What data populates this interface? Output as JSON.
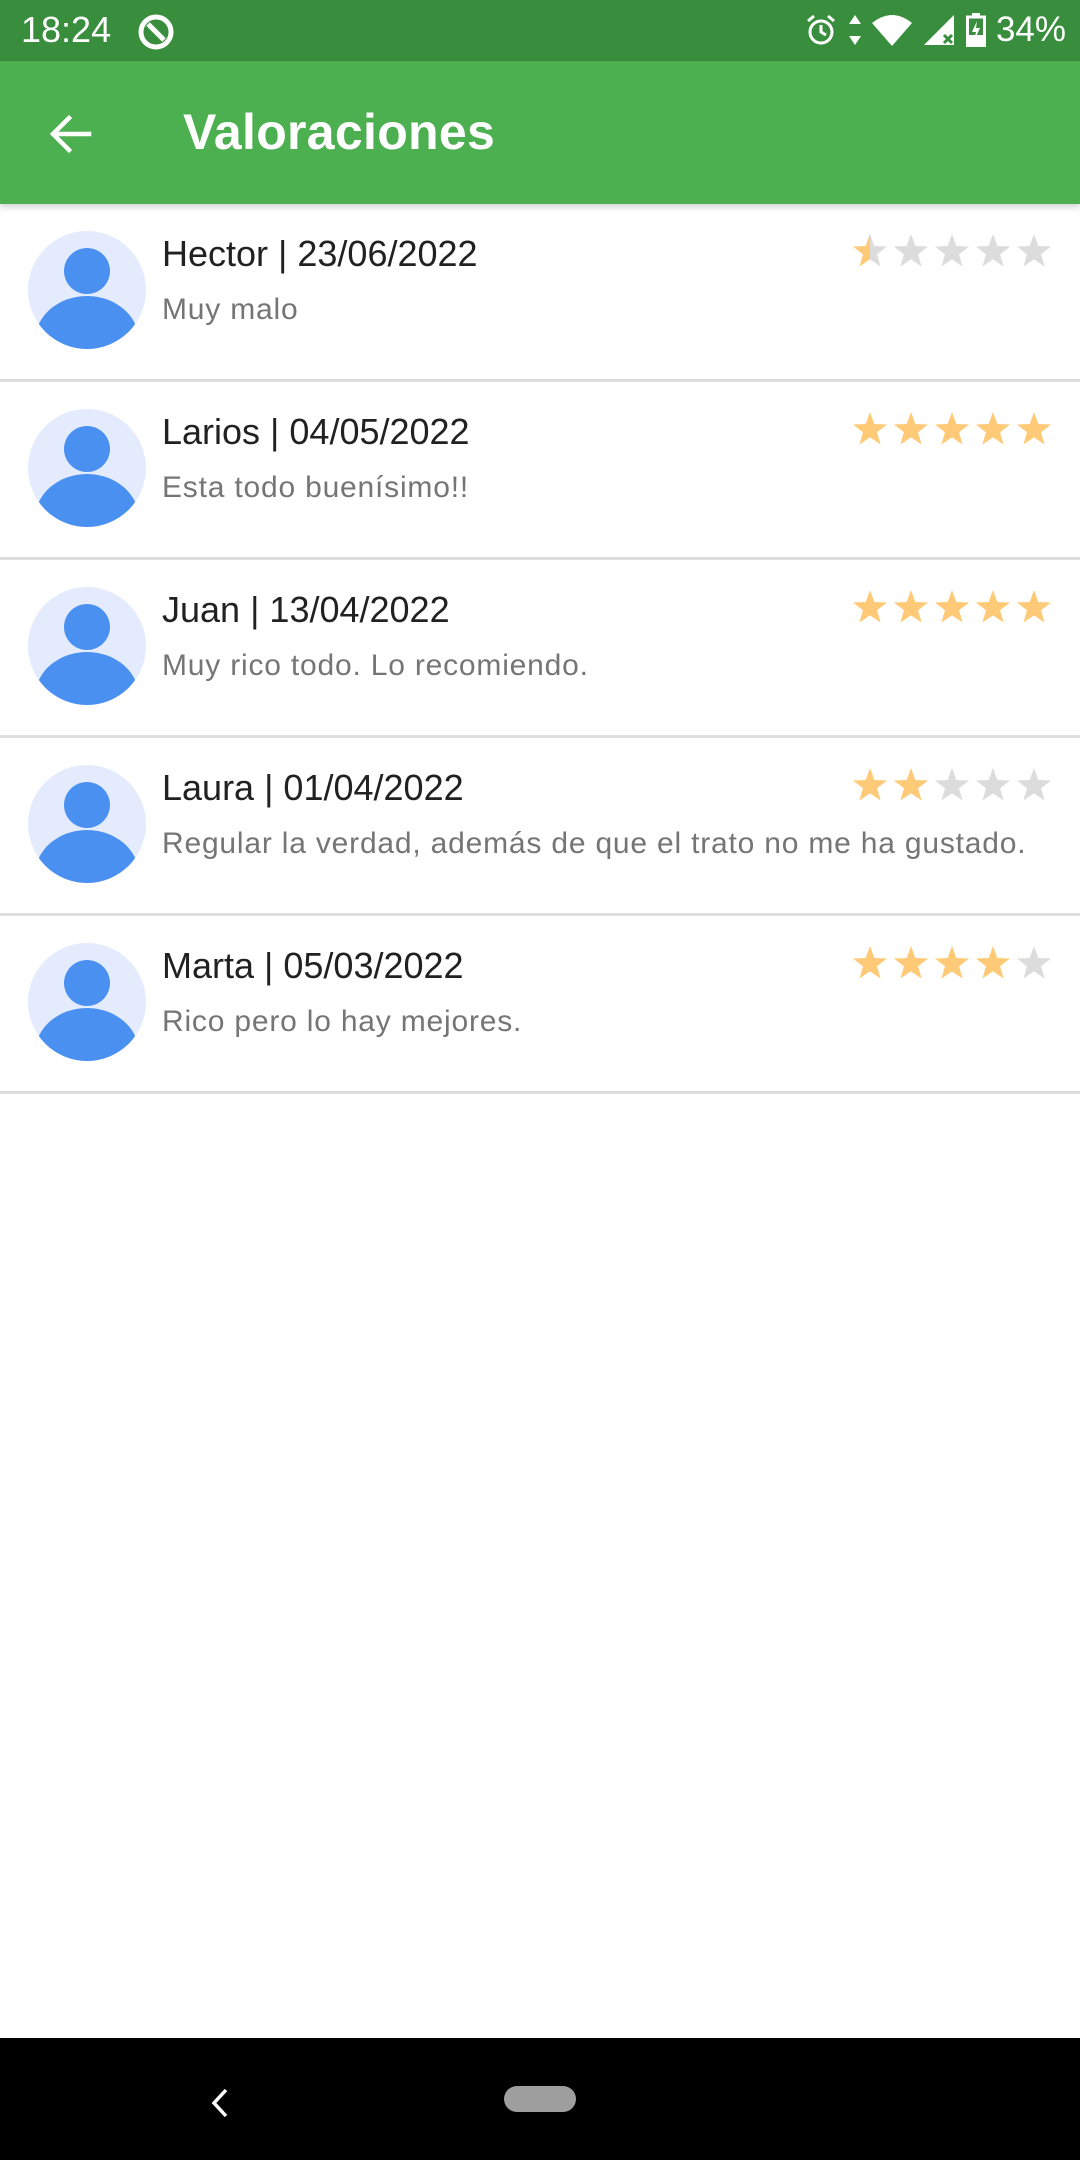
{
  "status_bar": {
    "time": "18:24",
    "battery": "34%",
    "icons": [
      "app-notification-icon",
      "alarm-icon",
      "data-arrows-icon",
      "wifi-icon",
      "cell-signal-icon",
      "battery-charging-icon"
    ]
  },
  "app_bar": {
    "title": "Valoraciones",
    "back_icon": "arrow-back-icon",
    "background": "#4caf50",
    "status_background": "#388e3c"
  },
  "colors": {
    "star_filled": "#ffca78",
    "star_empty": "#dcdcdc",
    "avatar_bg": "#e3ebfd",
    "avatar_fg": "#4a90f0"
  },
  "reviews": [
    {
      "header": "Hector | 23/06/2022",
      "comment": "Muy malo",
      "rating": 0.5
    },
    {
      "header": "Larios | 04/05/2022",
      "comment": "Esta todo buenísimo!!",
      "rating": 5
    },
    {
      "header": "Juan | 13/04/2022",
      "comment": "Muy rico todo. Lo recomiendo.",
      "rating": 5
    },
    {
      "header": "Laura | 01/04/2022",
      "comment": "Regular la verdad, además de que el trato no me ha gustado.",
      "rating": 2
    },
    {
      "header": "Marta | 05/03/2022",
      "comment": "Rico pero lo hay mejores.",
      "rating": 4
    }
  ],
  "rating_max": 5,
  "nav_bar": {
    "icons": [
      "nav-back-icon",
      "home-pill-icon"
    ]
  }
}
